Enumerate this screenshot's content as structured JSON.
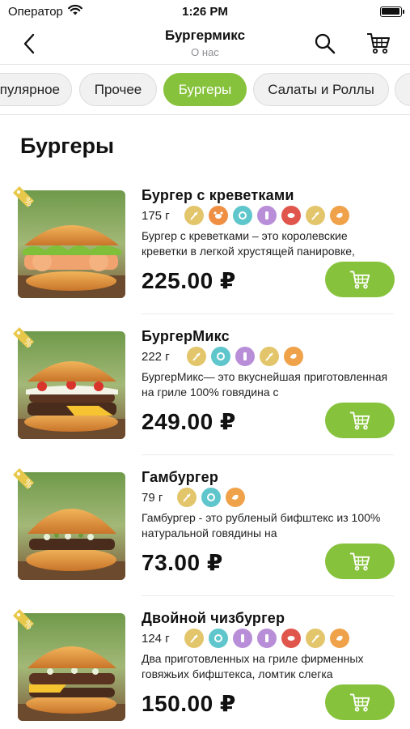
{
  "status_bar": {
    "carrier": "Оператор",
    "time": "1:26 PM"
  },
  "nav": {
    "title": "Бургермикс",
    "subtitle": "О нас"
  },
  "tabs": [
    {
      "label": "пулярное"
    },
    {
      "label": "Прочее"
    },
    {
      "label": "Бургеры",
      "active": true
    },
    {
      "label": "Салаты и Роллы"
    },
    {
      "label": ""
    }
  ],
  "section": {
    "title": "Бургеры"
  },
  "colors": {
    "accent": "#86c23b",
    "badge": "#e8c84a"
  },
  "products": [
    {
      "name": "Бургер с креветками",
      "weight": "175 г",
      "description": "Бургер с креветками – это королевские креветки в легкой хрустящей панировке,",
      "price": "225.00 ₽",
      "allergens": [
        "wheat-icon",
        "crab-icon",
        "milk-icon",
        "bottle-icon",
        "meat-icon",
        "wheat-icon",
        "chicken-icon"
      ]
    },
    {
      "name": "БургерМикс",
      "weight": "222 г",
      "description": "БургерМикс— это вкуснейшая приготовленная на гриле 100% говядина с",
      "price": "249.00 ₽",
      "allergens": [
        "wheat-icon",
        "milk-icon",
        "bottle-icon",
        "wheat-icon",
        "chicken-icon"
      ]
    },
    {
      "name": "Гамбургер",
      "weight": "79 г",
      "description": "Гамбургер - это рубленый бифштекс из 100% натуральной говядины на",
      "price": "73.00 ₽",
      "allergens": [
        "wheat-icon",
        "milk-icon",
        "chicken-icon"
      ]
    },
    {
      "name": "Двойной чизбургер",
      "weight": "124 г",
      "description": "Два приготовленных на гриле фирменных говяжьих бифштекса,  ломтик слегка",
      "price": "150.00 ₽",
      "allergens": [
        "wheat-icon",
        "milk-icon",
        "bottle-icon",
        "bottle-icon",
        "meat-icon",
        "wheat-icon",
        "chicken-icon"
      ]
    }
  ]
}
